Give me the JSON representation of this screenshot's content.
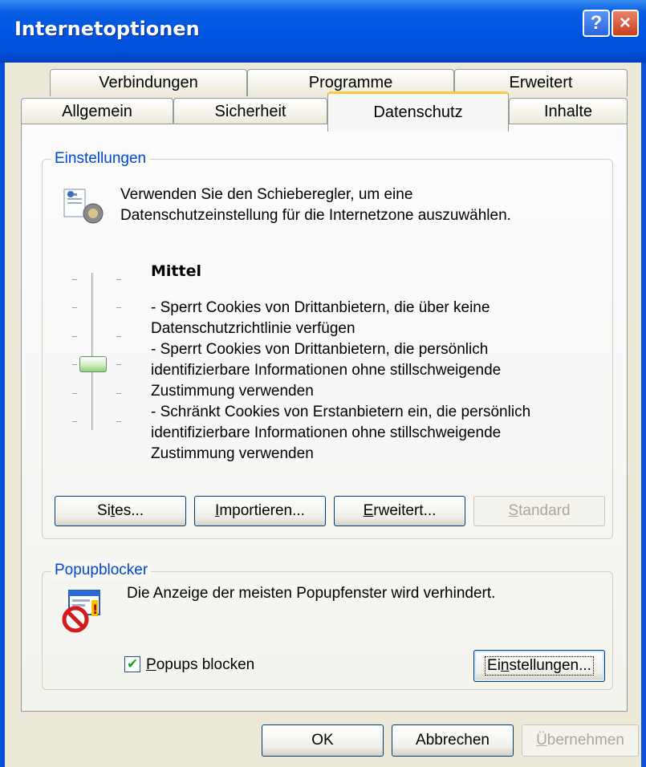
{
  "window": {
    "title": "Internetoptionen",
    "help_glyph": "?",
    "close_glyph": "×"
  },
  "tabs": {
    "row1": [
      "Verbindungen",
      "Programme",
      "Erweitert"
    ],
    "row2": [
      "Allgemein",
      "Sicherheit",
      "Datenschutz",
      "Inhalte"
    ],
    "active": "Datenschutz"
  },
  "settings_group": {
    "label": "Einstellungen",
    "intro_line1": "Verwenden Sie den Schieberegler, um eine",
    "intro_line2": "Datenschutzeinstellung für die Internetzone auszuwählen.",
    "level_name": "Mittel",
    "slider_level": 0.6,
    "description_lines": [
      "- Sperrt Cookies von Drittanbietern, die über keine",
      "Datenschutzrichtlinie verfügen",
      "- Sperrt Cookies von Drittanbietern, die persönlich",
      "identifizierbare Informationen ohne stillschweigende",
      "Zustimmung verwenden",
      "- Schränkt Cookies von Erstanbietern ein, die persönlich",
      "identifizierbare Informationen ohne stillschweigende",
      "Zustimmung verwenden"
    ],
    "buttons": {
      "sites": {
        "pre": "Si",
        "mnemonic": "t",
        "post": "es..."
      },
      "importieren": {
        "pre": "",
        "mnemonic": "I",
        "post": "mportieren..."
      },
      "erweitert": {
        "pre": "",
        "mnemonic": "E",
        "post": "rweitert..."
      },
      "standard": {
        "pre": "",
        "mnemonic": "S",
        "post": "tandard"
      }
    }
  },
  "popup_group": {
    "label": "Popupblocker",
    "description": "Die Anzeige der meisten Popupfenster wird verhindert.",
    "checkbox": {
      "checked": true,
      "check_glyph": "✔",
      "pre": "",
      "mnemonic": "P",
      "post": "opups blocken"
    },
    "settings_button": {
      "pre": "Ei",
      "mnemonic": "n",
      "post": "stellungen..."
    }
  },
  "dialog_buttons": {
    "ok": "OK",
    "cancel": "Abbrechen",
    "apply": {
      "pre": "",
      "mnemonic": "Ü",
      "post": "bernehmen"
    }
  },
  "colors": {
    "title_bar": "#0054e3",
    "group_label": "#0046d5",
    "active_tab_highlight": "#ffc83c",
    "window_background": "#ece9d8"
  }
}
